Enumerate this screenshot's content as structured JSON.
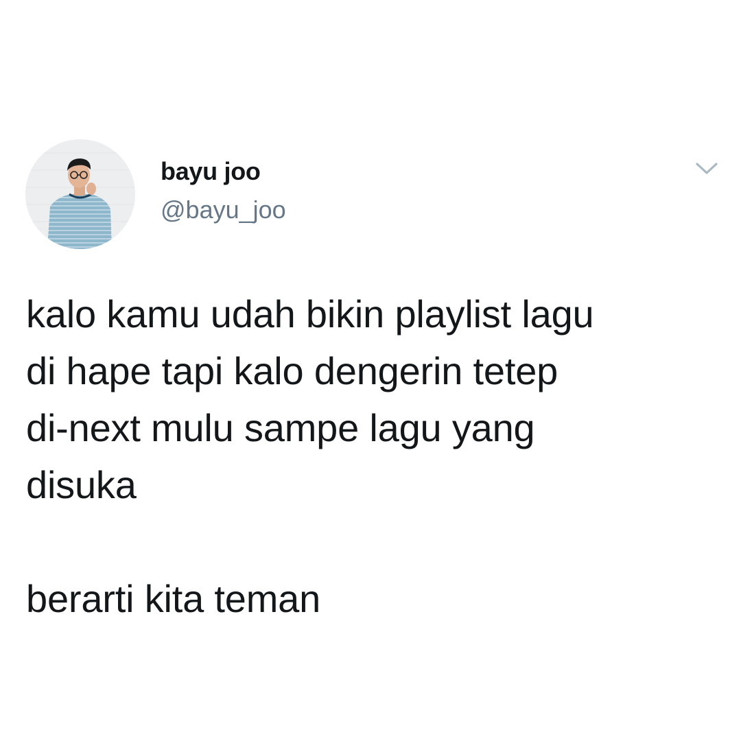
{
  "tweet": {
    "author": {
      "display_name": "bayu joo",
      "handle": "@bayu_joo",
      "avatar_icon": "user-photo-avatar"
    },
    "menu_icon": "chevron-down-icon",
    "text": "kalo kamu udah bikin playlist lagu\ndi hape tapi kalo dengerin tetep\ndi-next mulu sampe lagu yang\ndisuka\n\nberarti kita teman"
  },
  "colors": {
    "background": "#ffffff",
    "text_primary": "#14171a",
    "text_secondary": "#657786",
    "caret": "#aab8c2"
  }
}
